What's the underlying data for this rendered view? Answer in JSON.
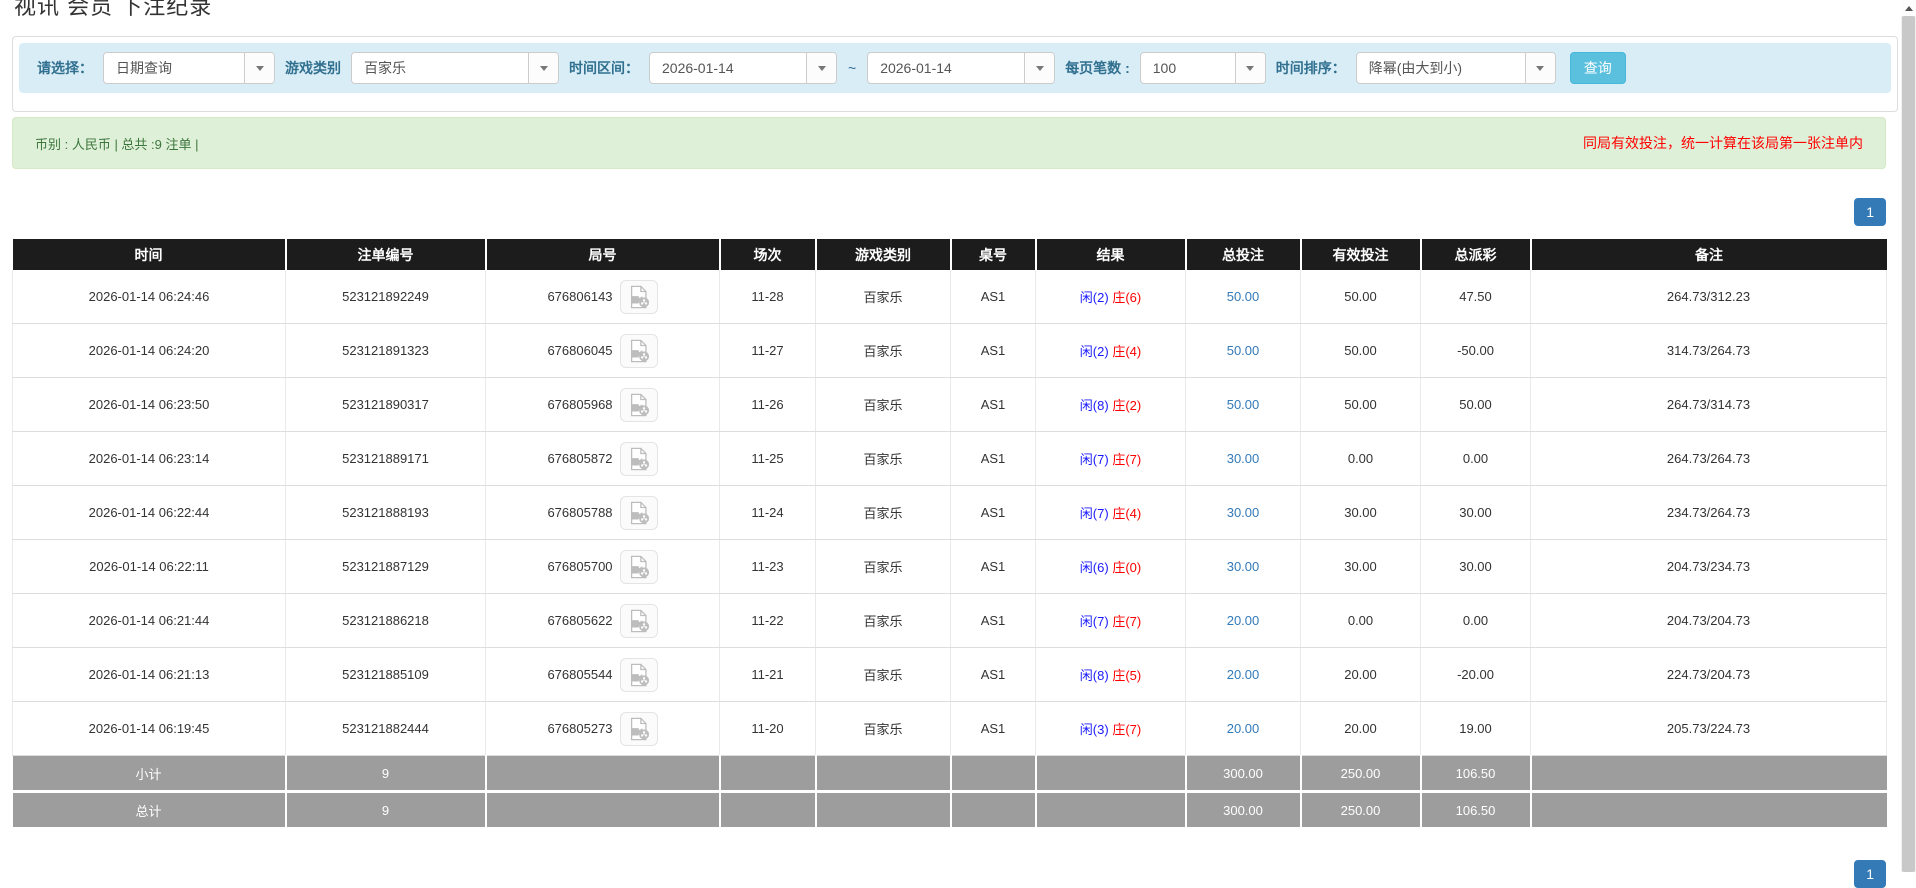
{
  "title": "视讯 会员 下注纪录",
  "filters": {
    "select_label": "请选择：",
    "select_value": "日期查询",
    "game_label": "游戏类别",
    "game_value": "百家乐",
    "range_label": "时间区间：",
    "date_from": "2026-01-14",
    "range_separator": "~",
    "date_to": "2026-01-14",
    "per_page_label": "每页笔数 :",
    "per_page_value": "100",
    "sort_label": "时间排序：",
    "sort_value": "降幂(由大到小)",
    "search_label": "查询"
  },
  "summary_bar": {
    "left_text": "币别 : 人民币 | 总共 :9 注单 |",
    "right_text": "同局有效投注，统一计算在该局第一张注单内"
  },
  "pagination": {
    "current_page": "1"
  },
  "table": {
    "headers": [
      "时间",
      "注单编号",
      "局号",
      "场次",
      "游戏类别",
      "桌号",
      "结果",
      "总投注",
      "有效投注",
      "总派彩",
      "备注"
    ],
    "rows": [
      {
        "time": "2026-01-14 06:24:46",
        "bet_no": "523121892249",
        "round_no": "676806143",
        "session": "11-28",
        "game": "百家乐",
        "table_no": "AS1",
        "result_player": "闲(2)",
        "result_banker": "庄(6)",
        "total_bet": "50.00",
        "valid_bet": "50.00",
        "payout": "47.50",
        "note": "264.73/312.23"
      },
      {
        "time": "2026-01-14 06:24:20",
        "bet_no": "523121891323",
        "round_no": "676806045",
        "session": "11-27",
        "game": "百家乐",
        "table_no": "AS1",
        "result_player": "闲(2)",
        "result_banker": "庄(4)",
        "total_bet": "50.00",
        "valid_bet": "50.00",
        "payout": "-50.00",
        "note": "314.73/264.73"
      },
      {
        "time": "2026-01-14 06:23:50",
        "bet_no": "523121890317",
        "round_no": "676805968",
        "session": "11-26",
        "game": "百家乐",
        "table_no": "AS1",
        "result_player": "闲(8)",
        "result_banker": "庄(2)",
        "total_bet": "50.00",
        "valid_bet": "50.00",
        "payout": "50.00",
        "note": "264.73/314.73"
      },
      {
        "time": "2026-01-14 06:23:14",
        "bet_no": "523121889171",
        "round_no": "676805872",
        "session": "11-25",
        "game": "百家乐",
        "table_no": "AS1",
        "result_player": "闲(7)",
        "result_banker": "庄(7)",
        "total_bet": "30.00",
        "valid_bet": "0.00",
        "payout": "0.00",
        "note": "264.73/264.73"
      },
      {
        "time": "2026-01-14 06:22:44",
        "bet_no": "523121888193",
        "round_no": "676805788",
        "session": "11-24",
        "game": "百家乐",
        "table_no": "AS1",
        "result_player": "闲(7)",
        "result_banker": "庄(4)",
        "total_bet": "30.00",
        "valid_bet": "30.00",
        "payout": "30.00",
        "note": "234.73/264.73"
      },
      {
        "time": "2026-01-14 06:22:11",
        "bet_no": "523121887129",
        "round_no": "676805700",
        "session": "11-23",
        "game": "百家乐",
        "table_no": "AS1",
        "result_player": "闲(6)",
        "result_banker": "庄(0)",
        "total_bet": "30.00",
        "valid_bet": "30.00",
        "payout": "30.00",
        "note": "204.73/234.73"
      },
      {
        "time": "2026-01-14 06:21:44",
        "bet_no": "523121886218",
        "round_no": "676805622",
        "session": "11-22",
        "game": "百家乐",
        "table_no": "AS1",
        "result_player": "闲(7)",
        "result_banker": "庄(7)",
        "total_bet": "20.00",
        "valid_bet": "0.00",
        "payout": "0.00",
        "note": "204.73/204.73"
      },
      {
        "time": "2026-01-14 06:21:13",
        "bet_no": "523121885109",
        "round_no": "676805544",
        "session": "11-21",
        "game": "百家乐",
        "table_no": "AS1",
        "result_player": "闲(8)",
        "result_banker": "庄(5)",
        "total_bet": "20.00",
        "valid_bet": "20.00",
        "payout": "-20.00",
        "note": "224.73/204.73"
      },
      {
        "time": "2026-01-14 06:19:45",
        "bet_no": "523121882444",
        "round_no": "676805273",
        "session": "11-20",
        "game": "百家乐",
        "table_no": "AS1",
        "result_player": "闲(3)",
        "result_banker": "庄(7)",
        "total_bet": "20.00",
        "valid_bet": "20.00",
        "payout": "19.00",
        "note": "205.73/224.73"
      }
    ],
    "subtotal": {
      "label": "小计",
      "count": "9",
      "total_bet": "300.00",
      "valid_bet": "250.00",
      "payout": "106.50"
    },
    "grand_total": {
      "label": "总计",
      "count": "9",
      "total_bet": "300.00",
      "valid_bet": "250.00",
      "payout": "106.50"
    }
  },
  "colors": {
    "accent_blue": "#337ab7",
    "player_blue": "#1a1aff",
    "banker_red": "#ff0000",
    "negative_red": "#ff0000",
    "filter_bar_bg": "#d9edf7",
    "summary_bar_bg": "#dff0d8",
    "table_header_bg": "#1c1c1c",
    "total_row_bg": "#9d9d9d",
    "search_button_bg": "#5bc0de"
  }
}
